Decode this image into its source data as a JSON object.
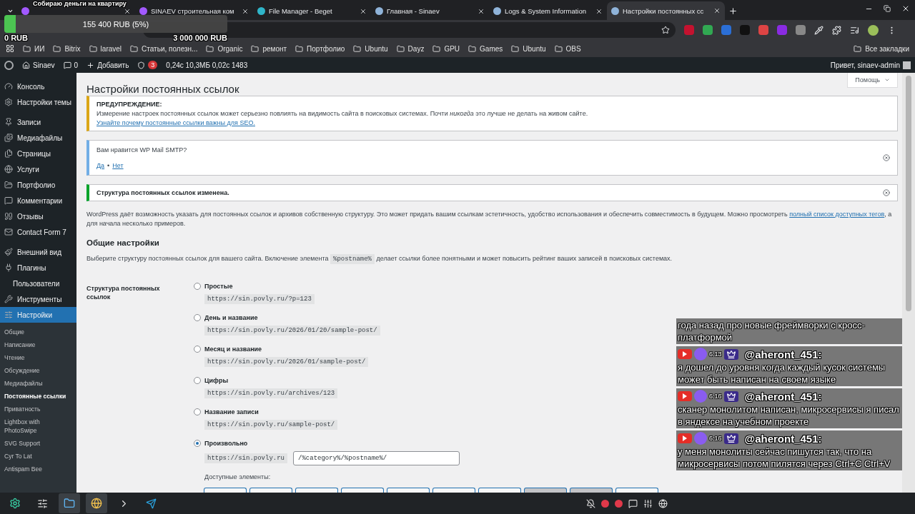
{
  "donation": {
    "title": "Собираю деньги на квартиру",
    "amount": "155 400 RUB (5%)",
    "level": 0.05,
    "min": "0 RUB",
    "max": "3 000 000 RUB"
  },
  "tabs": [
    {
      "selected": false
    },
    {
      "title": "SINAEV строительная ком",
      "selected": false
    },
    {
      "title": "File Manager - Beget",
      "selected": false
    },
    {
      "title": "Главная - Sinaev",
      "selected": false
    },
    {
      "title": "Logs & System Information",
      "selected": false
    },
    {
      "title": "Настройки постоянных сс",
      "selected": true
    }
  ],
  "bookmarks": [
    "ИИ",
    "Bitrix",
    "laravel",
    "Статьи, полезн...",
    "Organic",
    "ремонт",
    "Портфолио",
    "Ubuntu",
    "Dayz",
    "GPU",
    "Games",
    "Ubuntu",
    "OBS"
  ],
  "all_bookmarks": "Все закладки",
  "admin_bar": {
    "site": "Sinaev",
    "comments": "0",
    "new": "Добавить",
    "seo_count": "3",
    "stats": "0,24с 10,3МБ 0,02с 1483",
    "greeting": "Привет, sinaev-admin"
  },
  "menu_groups": [
    {
      "items": [
        {
          "label": "Консоль",
          "selected": false
        },
        {
          "label": "Настройки темы",
          "selected": false
        }
      ]
    },
    {
      "items": [
        {
          "label": "Записи",
          "selected": false
        },
        {
          "label": "Медиафайлы",
          "selected": false
        },
        {
          "label": "Страницы",
          "selected": false
        },
        {
          "label": "Услуги",
          "selected": false
        },
        {
          "label": "Портфолио",
          "selected": false
        },
        {
          "label": "Комментарии",
          "selected": false
        },
        {
          "label": "Отзывы",
          "selected": false
        },
        {
          "label": "Contact Form 7",
          "selected": false
        }
      ]
    },
    {
      "items": [
        {
          "label": "Внешний вид",
          "selected": false
        },
        {
          "label": "Плагины",
          "selected": false
        },
        {
          "label": "Пользователи",
          "selected": false
        },
        {
          "label": "Инструменты",
          "selected": false
        },
        {
          "label": "Настройки",
          "selected": true
        }
      ]
    }
  ],
  "submenu": [
    {
      "label": "Общие",
      "selected": false
    },
    {
      "label": "Написание",
      "selected": false
    },
    {
      "label": "Чтение",
      "selected": false
    },
    {
      "label": "Обсуждение",
      "selected": false
    },
    {
      "label": "Медиафайлы",
      "selected": false
    },
    {
      "label": "Постоянные ссылки",
      "selected": true
    },
    {
      "label": "Приватность",
      "selected": false
    },
    {
      "label": "Lightbox with PhotoSwipe",
      "selected": false
    },
    {
      "label": "SVG Support",
      "selected": false
    },
    {
      "label": "Cyr To Lat",
      "selected": false
    },
    {
      "label": "Antispam Bee",
      "selected": false
    }
  ],
  "page": {
    "title": "Настройки постоянных ссылок",
    "help": "Помощь",
    "warning": {
      "heading": "ПРЕДУПРЕЖДЕНИЕ:",
      "text": "Измерение настроек постоянных ссылок может серьезно повлиять на видимость сайта в поисковых системах. Почти *никогда* это лучше не делать на живом сайте.",
      "link": "Узнайте почему постоянные ссылки важны для SEO."
    },
    "smtp_notice": {
      "question": "Вам нравится WP Mail SMTP?",
      "yes": "Да",
      "separator": "•",
      "no": "Нет"
    },
    "success_notice": "Структура постоянных ссылок изменена.",
    "intro": {
      "before": "WordPress даёт возможность указать для постоянных ссылок и архивов собственную структуру. Это может придать вашим ссылкам эстетичность, удобство использования и обеспечить совместимость в будущем. Можно просмотреть",
      "link": "полный список доступных тегов",
      "after": ", а для начала несколько примеров."
    },
    "section_title": "Общие настройки",
    "section_desc": {
      "before": "Выберите структуру постоянных ссылок для вашего сайта. Включение элемента",
      "code": "%postname%",
      "after": "делает ссылки более понятными и может повысить рейтинг ваших записей в поисковых системах."
    },
    "field_label": "Структура постоянных ссылок",
    "options": [
      {
        "kind": "preset",
        "label": "Простые",
        "example": "https://sin.povly.ru/?p=123",
        "selected": false
      },
      {
        "kind": "preset",
        "label": "День и название",
        "example": "https://sin.povly.ru/2026/01/20/sample-post/",
        "selected": false
      },
      {
        "kind": "preset",
        "label": "Месяц и название",
        "example": "https://sin.povly.ru/2026/01/sample-post/",
        "selected": false
      },
      {
        "kind": "preset",
        "label": "Цифры",
        "example": "https://sin.povly.ru/archives/123",
        "selected": false
      },
      {
        "kind": "preset",
        "label": "Название записи",
        "example": "https://sin.povly.ru/sample-post/",
        "selected": false
      },
      {
        "kind": "custom",
        "label": "Произвольно",
        "example": "https://sin.povly.ru",
        "value": "/%category%/%postname%/",
        "selected": true
      }
    ],
    "available_label": "Доступные элементы:",
    "tags": [
      {
        "selected": false
      },
      {
        "selected": false
      },
      {
        "selected": false
      },
      {
        "selected": false
      },
      {
        "selected": false
      },
      {
        "selected": false
      },
      {
        "selected": false
      },
      {
        "selected": true
      },
      {
        "selected": true
      },
      {
        "selected": false
      }
    ]
  },
  "chat": [
    {
      "kind": "continuation",
      "text": "года назад про новые фреймворки с кросс-платформой"
    },
    {
      "kind": "message",
      "time": "6:13",
      "user": "@aheront_451:",
      "text": "я дошел до уровня когда каждый кусок системы может быть написан на своем языке"
    },
    {
      "kind": "message",
      "time": "6:16",
      "user": "@aheront_451:",
      "text": "сканер монолитом написан, микросервисы я писал в яндексе на учебном проекте"
    },
    {
      "kind": "message",
      "time": "6:16",
      "user": "@aheront_451:",
      "text": "у меня монолиты сейчас пишутся так, что на микросервисы потом пилятся через Ctrl+C Ctrl+V"
    }
  ]
}
